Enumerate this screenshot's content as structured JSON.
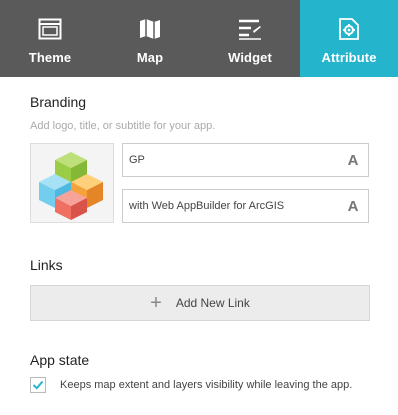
{
  "tabs": [
    {
      "label": "Theme",
      "icon": "theme-window-icon"
    },
    {
      "label": "Map",
      "icon": "map-icon"
    },
    {
      "label": "Widget",
      "icon": "widget-list-icon"
    },
    {
      "label": "Attribute",
      "icon": "attribute-gear-icon"
    }
  ],
  "colors": {
    "tabbar": "#5a5a5a",
    "active_tab": "#24b5cc",
    "checkbox_accent": "#24b5cc"
  },
  "branding": {
    "title": "Branding",
    "hint": "Add logo, title, or subtitle for your app.",
    "title_value": "GP",
    "subtitle_value": "with Web AppBuilder for ArcGIS",
    "font_button": "A"
  },
  "links": {
    "title": "Links",
    "add_label": "Add New Link"
  },
  "app_state": {
    "title": "App state",
    "checkbox_label": "Keeps map extent and layers visibility while leaving the app.",
    "checked": true
  }
}
